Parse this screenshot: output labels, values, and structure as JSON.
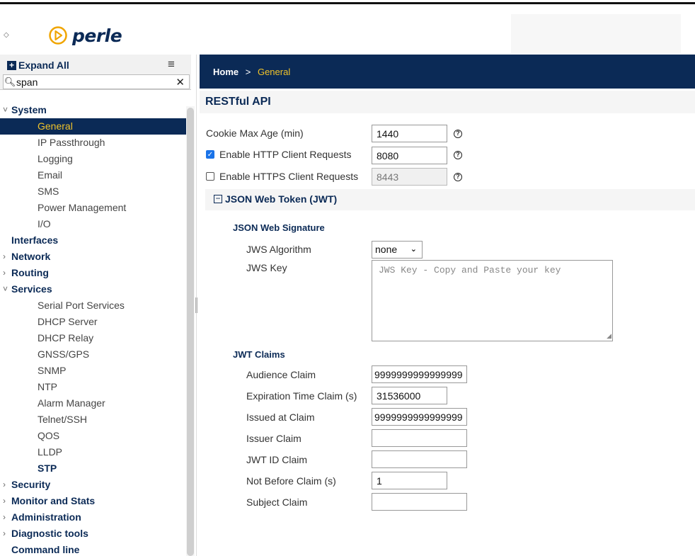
{
  "header": {
    "brand": "perle",
    "collapse_arrow": "◇"
  },
  "sidebar": {
    "expand_all": "Expand All",
    "search": {
      "value": "span",
      "placeholder": ""
    },
    "items": [
      {
        "kind": "top",
        "label": "System",
        "chevron": "˅",
        "state": "expanded"
      },
      {
        "kind": "sub",
        "label": "General",
        "active": true
      },
      {
        "kind": "sub",
        "label": "IP Passthrough"
      },
      {
        "kind": "sub",
        "label": "Logging"
      },
      {
        "kind": "sub",
        "label": "Email"
      },
      {
        "kind": "sub",
        "label": "SMS"
      },
      {
        "kind": "sub",
        "label": "Power Management"
      },
      {
        "kind": "sub",
        "label": "I/O"
      },
      {
        "kind": "top",
        "label": "Interfaces",
        "chevron": ""
      },
      {
        "kind": "top",
        "label": "Network",
        "chevron": "›"
      },
      {
        "kind": "top",
        "label": "Routing",
        "chevron": "›"
      },
      {
        "kind": "top",
        "label": "Services",
        "chevron": "˅"
      },
      {
        "kind": "sub",
        "label": "Serial Port Services"
      },
      {
        "kind": "sub",
        "label": "DHCP Server"
      },
      {
        "kind": "sub",
        "label": "DHCP Relay"
      },
      {
        "kind": "sub",
        "label": "GNSS/GPS"
      },
      {
        "kind": "sub",
        "label": "SNMP"
      },
      {
        "kind": "sub",
        "label": "NTP"
      },
      {
        "kind": "sub",
        "label": "Alarm Manager"
      },
      {
        "kind": "sub",
        "label": "Telnet/SSH"
      },
      {
        "kind": "sub",
        "label": "QOS"
      },
      {
        "kind": "sub",
        "label": "LLDP"
      },
      {
        "kind": "sub",
        "label": "STP",
        "bold": true
      },
      {
        "kind": "top",
        "label": "Security",
        "chevron": "›"
      },
      {
        "kind": "top",
        "label": "Monitor and Stats",
        "chevron": "›"
      },
      {
        "kind": "top",
        "label": "Administration",
        "chevron": "›"
      },
      {
        "kind": "top",
        "label": "Diagnostic tools",
        "chevron": "›"
      },
      {
        "kind": "top",
        "label": "Command line",
        "chevron": ""
      }
    ]
  },
  "breadcrumb": {
    "home": "Home",
    "separator": ">",
    "current": "General"
  },
  "section": {
    "title": "RESTful API"
  },
  "restful": {
    "cookie_max_age": {
      "label": "Cookie Max Age (min)",
      "value": "1440"
    },
    "http": {
      "label": "Enable HTTP Client Requests",
      "checked": true,
      "value": "8080"
    },
    "https": {
      "label": "Enable HTTPS Client Requests",
      "checked": false,
      "value": "8443"
    }
  },
  "jwt": {
    "title": "JSON Web Token (JWT)",
    "signature_heading": "JSON Web Signature",
    "algorithm": {
      "label": "JWS Algorithm",
      "value": "none"
    },
    "key": {
      "label": "JWS Key",
      "placeholder": "JWS Key - Copy and Paste your key"
    },
    "claims_heading": "JWT Claims",
    "claims": {
      "audience": {
        "label": "Audience Claim",
        "value": "9999999999999999"
      },
      "expiration": {
        "label": "Expiration Time Claim (s)",
        "value": "31536000"
      },
      "issued_at": {
        "label": "Issued at Claim",
        "value": "9999999999999999"
      },
      "issuer": {
        "label": "Issuer Claim",
        "value": ""
      },
      "jwt_id": {
        "label": "JWT ID Claim",
        "value": ""
      },
      "not_before": {
        "label": "Not Before Claim (s)",
        "value": "1"
      },
      "subject": {
        "label": "Subject Claim",
        "value": ""
      }
    }
  },
  "colors": {
    "navy": "#0b2a56",
    "accent": "#f0c32a",
    "logo": "#f0a500"
  }
}
